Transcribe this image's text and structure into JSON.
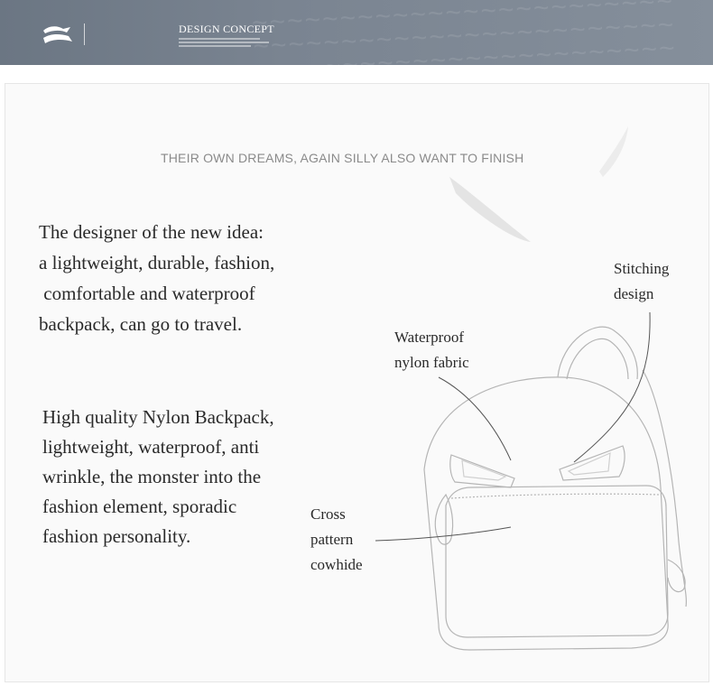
{
  "header": {
    "title": "DESIGN CONCEPT"
  },
  "tagline": "THEIR OWN DREAMS, AGAIN SILLY ALSO WANT TO FINISH",
  "paragraphs": {
    "designer_lines": [
      "The designer of the new idea:",
      "a lightweight, durable, fashion,",
      " comfortable and waterproof",
      "backpack, can go to travel."
    ],
    "quality_lines": [
      "High quality Nylon Backpack,",
      "lightweight, waterproof, anti",
      "wrinkle, the monster into the",
      "fashion element, sporadic",
      "fashion personality."
    ]
  },
  "callouts": {
    "stitching": [
      "Stitching",
      "design"
    ],
    "waterproof": [
      "Waterproof",
      "nylon fabric"
    ],
    "cross": [
      "Cross",
      "pattern",
      "cowhide"
    ]
  },
  "icons": [
    "logo-icon",
    "feather-icon",
    "backpack-illustration"
  ]
}
